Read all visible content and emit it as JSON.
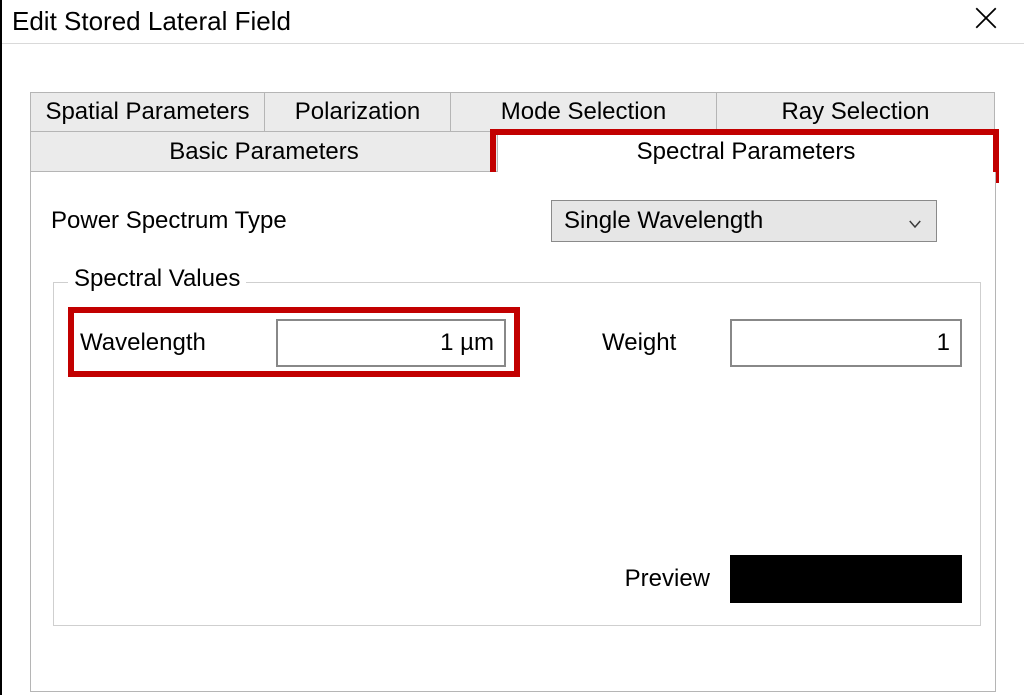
{
  "window": {
    "title": "Edit Stored Lateral Field"
  },
  "tabs": {
    "row1": {
      "spatial": "Spatial Parameters",
      "polarization": "Polarization",
      "mode_selection": "Mode Selection",
      "ray_selection": "Ray Selection"
    },
    "row2": {
      "basic": "Basic Parameters",
      "spectral": "Spectral Parameters"
    },
    "active": "spectral"
  },
  "spectral": {
    "power_spectrum_type_label": "Power Spectrum Type",
    "power_spectrum_type_value": "Single Wavelength",
    "group_legend": "Spectral Values",
    "wavelength_label": "Wavelength",
    "wavelength_value": "1 µm",
    "weight_label": "Weight",
    "weight_value": "1",
    "preview_label": "Preview",
    "preview_color": "#000000"
  },
  "highlights": {
    "spectral_tab": "#c20000",
    "wavelength_field": "#c20000"
  },
  "icons": {
    "close": "close-icon",
    "dropdown": "chevron-down-icon"
  }
}
